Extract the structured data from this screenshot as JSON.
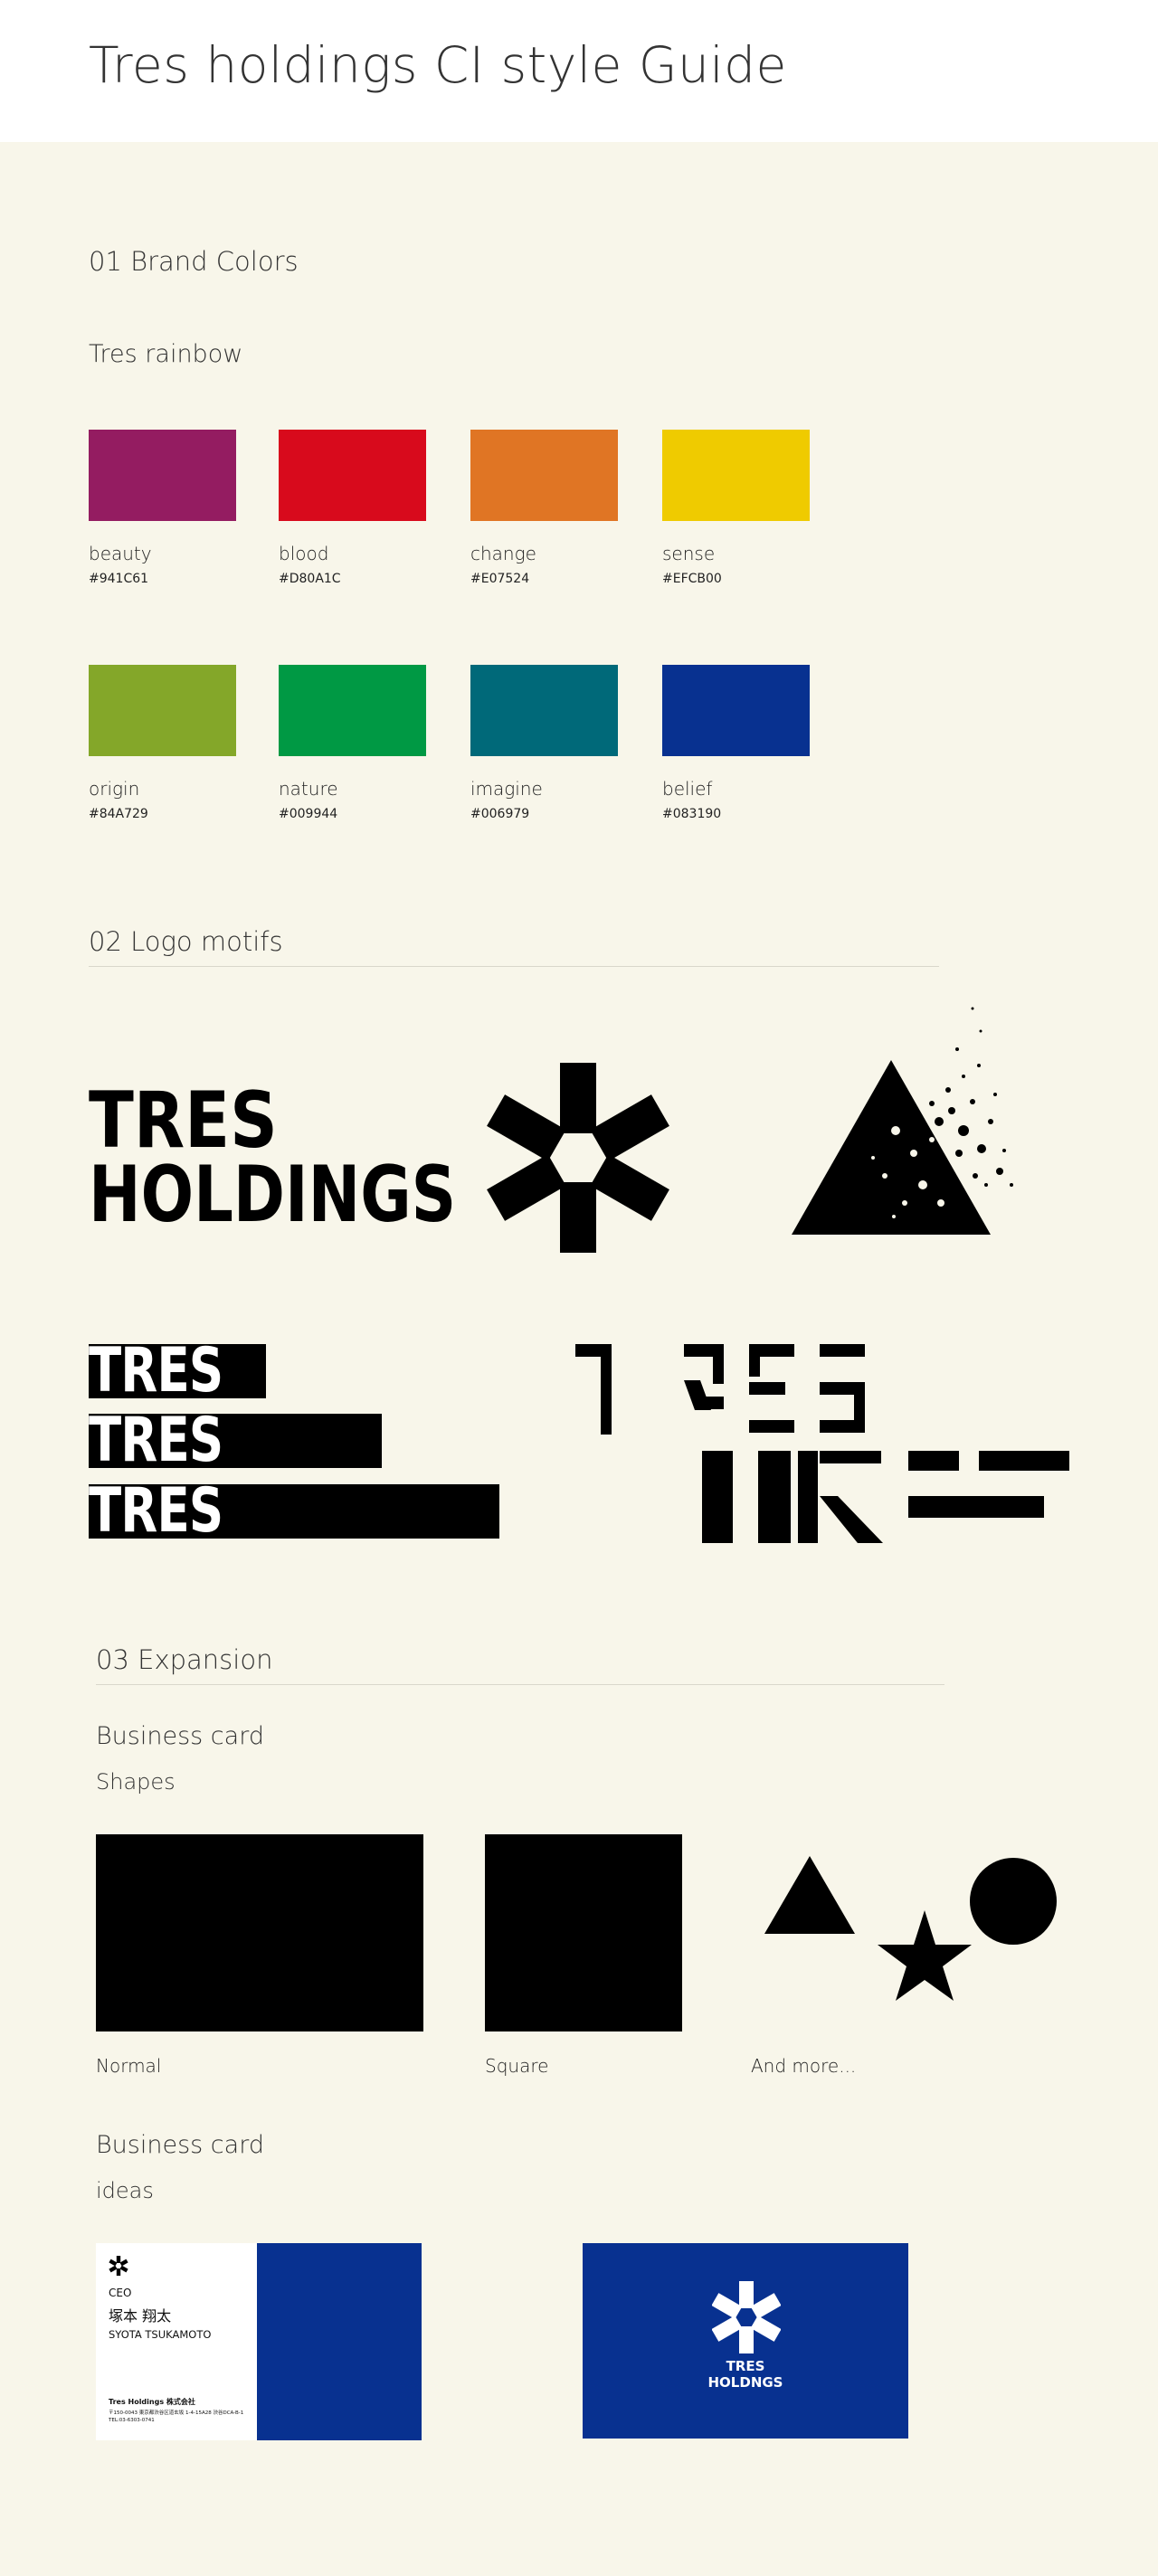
{
  "page": {
    "title": "Tres holdings CI style Guide"
  },
  "section1": {
    "heading": "01 Brand Colors",
    "subheading": "Tres rainbow",
    "colors": [
      {
        "name": "beauty",
        "hex": "#941C61",
        "color": "#941C61"
      },
      {
        "name": "blood",
        "hex": "#D80A1C",
        "color": "#D80A1C"
      },
      {
        "name": "change",
        "hex": "#E07524",
        "color": "#E07524"
      },
      {
        "name": "sense",
        "hex": "#EFCB00",
        "color": "#EFCB00"
      },
      {
        "name": "origin",
        "hex": "#84A729",
        "color": "#84A729"
      },
      {
        "name": "nature",
        "hex": "#009944",
        "color": "#009944"
      },
      {
        "name": "imagine",
        "hex": "#006979",
        "color": "#006979"
      },
      {
        "name": "belief",
        "hex": "#083190",
        "color": "#083190"
      }
    ]
  },
  "section2": {
    "heading": "02 Logo motifs",
    "wordmark": {
      "line1": "TRES",
      "line2": "HOLDINGS"
    },
    "stripe_word": "TRES"
  },
  "section3": {
    "heading": "03 Expansion",
    "card_shapes": {
      "title": "Business card",
      "subtitle": "Shapes",
      "captions": {
        "normal": "Normal",
        "square": "Square",
        "more": "And more..."
      }
    },
    "card_ideas": {
      "title": "Business card",
      "subtitle": "ideas",
      "card1": {
        "role": "CEO",
        "name_jp": "塚本 翔太",
        "name_en": "SYOTA TSUKAMOTO",
        "company": "Tres Holdings 株式会社",
        "address": "〒150-0043 東京都渋谷区道玄坂 1-4-15A28 渋谷DCA-B-1",
        "tel": "TEL:03-6303-0741",
        "accent": "#083190"
      },
      "card2": {
        "line1": "TRES",
        "line2": "HOLDNGS",
        "bg": "#083190"
      }
    }
  }
}
